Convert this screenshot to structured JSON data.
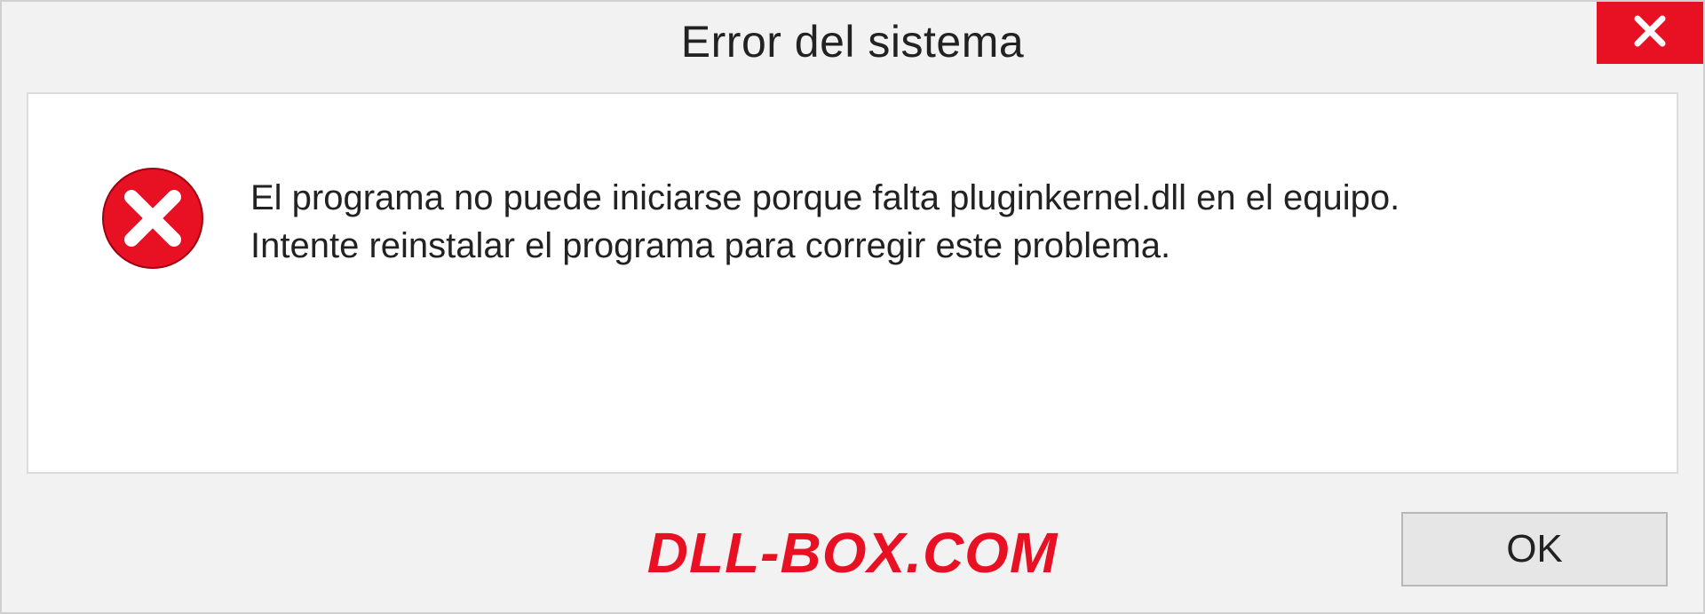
{
  "dialog": {
    "title": "Error del sistema",
    "message_line1": "El programa no puede iniciarse porque falta pluginkernel.dll en el equipo.",
    "message_line2": "Intente reinstalar el programa para corregir este problema.",
    "ok_label": "OK"
  },
  "watermark": "DLL-BOX.COM",
  "colors": {
    "accent_red": "#e81123",
    "dialog_bg": "#f2f2f2",
    "body_bg": "#ffffff"
  }
}
